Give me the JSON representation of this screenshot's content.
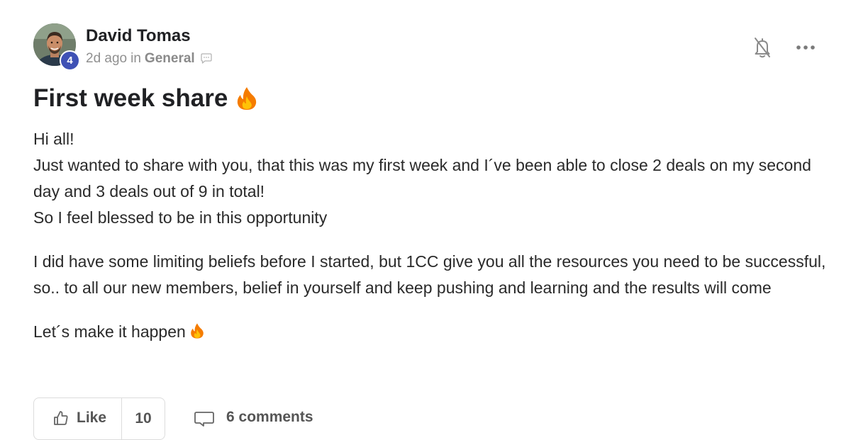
{
  "author": {
    "name": "David Tomas",
    "level": "4",
    "avatar_icon": "user-avatar"
  },
  "meta": {
    "time": "2d ago",
    "in_label": "in",
    "category": "General",
    "category_icon": "chat-bubble-icon"
  },
  "actions": {
    "bell_icon": "bell-off-icon",
    "more_icon": "more-horizontal-icon"
  },
  "post": {
    "title": "First week share",
    "title_emoji": "fire-emoji",
    "paragraphs": [
      {
        "lines": [
          "Hi all!",
          "Just wanted to share with you, that this was my first week and I´ve been able to close 2 deals on my second day and 3 deals out of 9 in total!",
          "So I feel blessed to be in this opportunity"
        ]
      },
      {
        "lines": [
          "I did have some limiting beliefs before I started, but 1CC give you all the resources you need to be successful, so.. to all our new members, belief in yourself and keep pushing and learning and the results will come"
        ]
      },
      {
        "lines": [
          "Let´s make it happen"
        ]
      }
    ]
  },
  "footer": {
    "like_label": "Like",
    "like_count": "10",
    "comments_label": "6 comments"
  },
  "colors": {
    "badge": "#3f51b5",
    "text": "#202124",
    "muted": "#909090",
    "fire": "#f57c00"
  }
}
